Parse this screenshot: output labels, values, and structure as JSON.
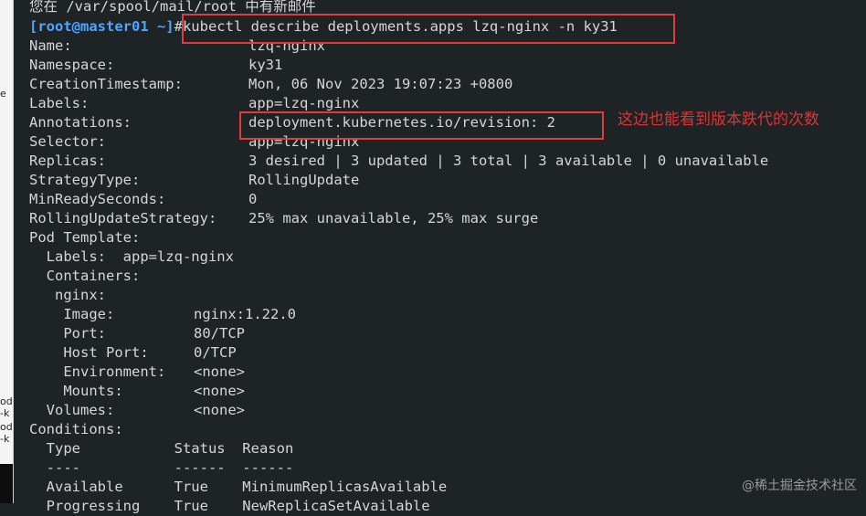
{
  "side_panel": {
    "fragments": [
      "e",
      "od",
      "-k",
      "od",
      "-k"
    ]
  },
  "terminal": {
    "mail_notice": "您在 /var/spool/mail/root 中有新邮件",
    "prompt": "[root@master01 ~]",
    "command": "#kubectl describe deployments.apps lzq-nginx -n ky31",
    "rows": [
      {
        "key": "Name:",
        "value": "lzq-nginx"
      },
      {
        "key": "Namespace:",
        "value": "ky31"
      },
      {
        "key": "CreationTimestamp:",
        "value": "Mon, 06 Nov 2023 19:07:23 +0800"
      },
      {
        "key": "Labels:",
        "value": "app=lzq-nginx"
      },
      {
        "key": "Annotations:",
        "value": "deployment.kubernetes.io/revision: 2"
      },
      {
        "key": "Selector:",
        "value": "app=lzq-nginx"
      },
      {
        "key": "Replicas:",
        "value": "3 desired | 3 updated | 3 total | 3 available | 0 unavailable"
      },
      {
        "key": "StrategyType:",
        "value": "RollingUpdate"
      },
      {
        "key": "MinReadySeconds:",
        "value": "0"
      },
      {
        "key": "RollingUpdateStrategy:",
        "value": "25% max unavailable, 25% max surge"
      }
    ],
    "pod_template": "Pod Template:",
    "pod_labels": "  Labels:  app=lzq-nginx",
    "containers": "  Containers:",
    "container_name": "   nginx:",
    "container_fields": [
      {
        "key": "    Image:",
        "value": "nginx:1.22.0"
      },
      {
        "key": "    Port:",
        "value": "80/TCP"
      },
      {
        "key": "    Host Port:",
        "value": "0/TCP"
      },
      {
        "key": "    Environment:",
        "value": "<none>"
      },
      {
        "key": "    Mounts:",
        "value": "<none>"
      },
      {
        "key": "  Volumes:",
        "value": "<none>"
      }
    ],
    "conditions": "Conditions:",
    "conditions_header": "  Type           Status  Reason",
    "conditions_sep": "  ----           ------  ------",
    "condition_rows": [
      "  Available      True    MinimumReplicasAvailable",
      "  Progressing    True    NewReplicaSetAvailable"
    ]
  },
  "annotation_text": "这边也能看到版本跌代的次数",
  "watermark": "@稀土掘金技术社区",
  "colors": {
    "background": "#1e2326",
    "text": "#d6d6d6",
    "prompt": "#4fa6ff",
    "highlight": "#e33b3b"
  }
}
